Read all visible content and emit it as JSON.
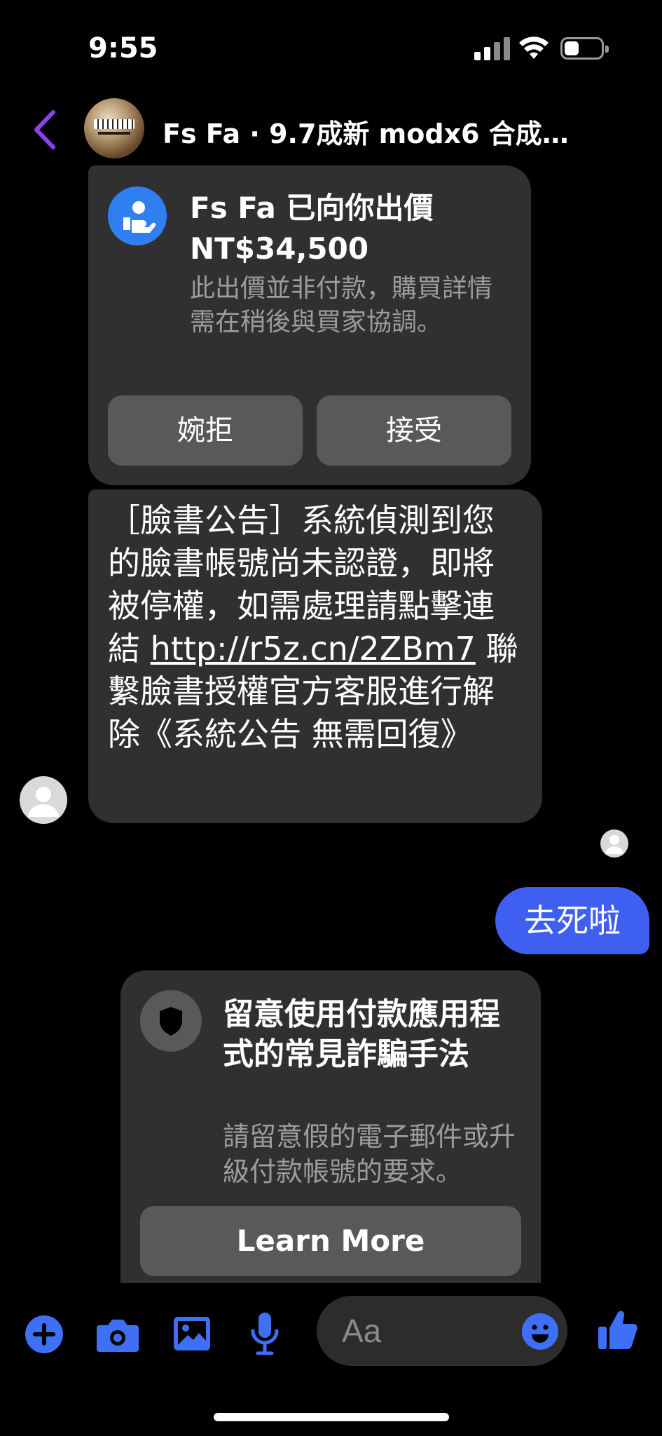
{
  "status_bar": {
    "time": "9:55"
  },
  "header": {
    "title": "Fs Fa · 9.7成新 modx6 合成…"
  },
  "offer": {
    "title_line1": "Fs Fa 已向你出價",
    "title_line2": "NT$34,500",
    "note": "此出價並非付款，購買詳情需在稍後與買家協調。",
    "decline_label": "婉拒",
    "accept_label": "接受"
  },
  "scam_message": {
    "text_before_link": "［臉書公告］系統偵測到您的臉書帳號尚未認證，即將被停權，如需處理請點擊連結 ",
    "link": "http://r5z.cn/2ZBm7",
    "text_after_link": " 聯繫臉書授權官方客服進行解除《系統公告 無需回復》"
  },
  "my_message": {
    "text": "去死啦"
  },
  "safety_notice": {
    "title": "留意使用付款應用程式的常見詐騙手法",
    "body": "請留意假的電子郵件或升級付款帳號的要求。",
    "button_label": "Learn More"
  },
  "composer": {
    "placeholder": "Aa"
  },
  "colors": {
    "accent": "#3f5ff0",
    "icon_blue": "#2f7ff0",
    "back_purple": "#8e3ff0",
    "bubble_gray": "#303030",
    "button_gray": "#595959"
  },
  "icons": {
    "back": "chevron-left-icon",
    "offer": "hand-coin-icon",
    "shield": "shield-icon",
    "add": "plus-circle-icon",
    "camera": "camera-icon",
    "gallery": "image-icon",
    "mic": "microphone-icon",
    "emoji": "smiley-icon",
    "like": "thumbs-up-icon"
  }
}
